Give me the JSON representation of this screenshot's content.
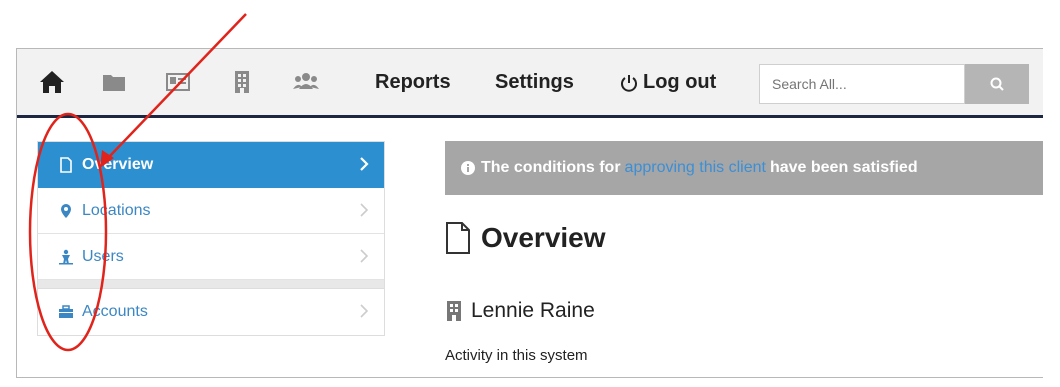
{
  "navbar": {
    "icons": [
      "home-icon",
      "folder-icon",
      "id-card-icon",
      "building-icon",
      "users-icon"
    ],
    "links": {
      "reports": "Reports",
      "settings": "Settings",
      "logout": "Log out"
    },
    "search": {
      "placeholder": "Search All..."
    }
  },
  "sidebar": {
    "items": [
      {
        "label": "Overview",
        "icon": "file-icon",
        "active": true
      },
      {
        "label": "Locations",
        "icon": "map-marker-icon",
        "active": false
      },
      {
        "label": "Users",
        "icon": "user-icon",
        "active": false
      },
      {
        "label": "Accounts",
        "icon": "briefcase-icon",
        "active": false
      }
    ]
  },
  "alert": {
    "prefix": "The conditions for",
    "link": "approving this client",
    "suffix": "have been satisfied"
  },
  "main": {
    "title": "Overview",
    "client_name": "Lennie Raine",
    "activity_heading": "Activity in this system"
  },
  "colors": {
    "active": "#2c8fd0",
    "link": "#3b8fd6",
    "navbar_border": "#1e2742",
    "alert_bg": "#a6a6a6",
    "annotation": "#e0241b"
  }
}
